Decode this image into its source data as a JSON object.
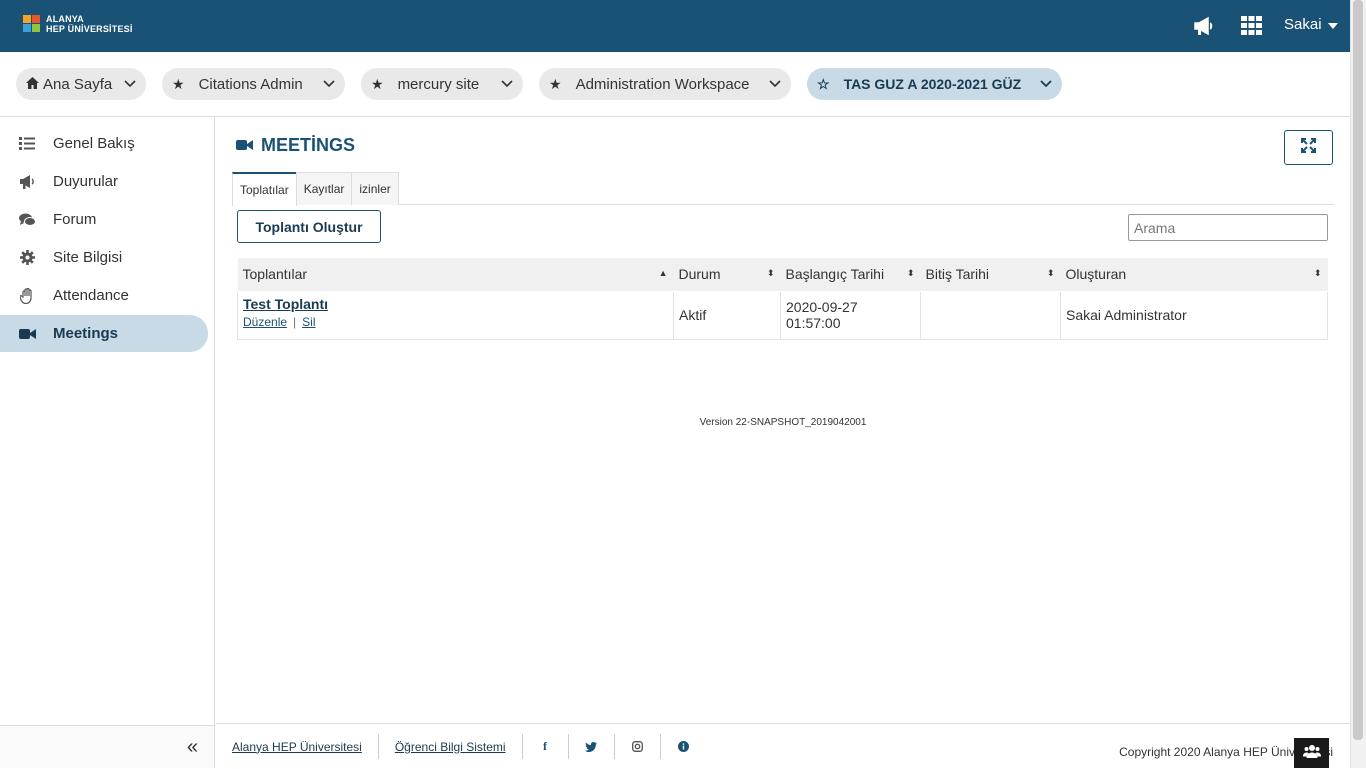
{
  "header": {
    "logo_line1": "ALANYA",
    "logo_line2": "HEP ÜNİVERSİTESİ",
    "user_name": "Sakai",
    "icons": [
      "bullhorn-icon",
      "apps-grid-icon"
    ]
  },
  "site_tabs": [
    {
      "label": "Ana Sayfa",
      "icon": "home-icon"
    },
    {
      "label": "Citations Admin",
      "icon": "star-icon"
    },
    {
      "label": "mercury site",
      "icon": "star-icon"
    },
    {
      "label": "Administration Workspace",
      "icon": "star-icon"
    },
    {
      "label": "TAS GUZ A 2020-2021 GÜZ",
      "icon": "star-outline-icon",
      "active": true
    }
  ],
  "sidebar": {
    "items": [
      {
        "label": "Genel Bakış",
        "icon": "list-icon"
      },
      {
        "label": "Duyurular",
        "icon": "bullhorn-icon"
      },
      {
        "label": "Forum",
        "icon": "comments-icon"
      },
      {
        "label": "Site Bilgisi",
        "icon": "gear-icon"
      },
      {
        "label": "Attendance",
        "icon": "hand-icon"
      },
      {
        "label": "Meetings",
        "icon": "video-camera-icon",
        "active": true
      }
    ]
  },
  "main": {
    "title": "MEETİNGS",
    "tabs": [
      {
        "label": "Toplatılar",
        "active": true
      },
      {
        "label": "Kayıtlar"
      },
      {
        "label": "izinler"
      }
    ],
    "create_button": "Toplantı Oluştur",
    "search_placeholder": "Arama",
    "table": {
      "headers": [
        "Toplantılar",
        "Durum",
        "Başlangıç Tarihi",
        "Bitiş Tarihi",
        "Oluşturan"
      ],
      "rows": [
        {
          "name": "Test Toplantı",
          "edit": "Düzenle",
          "separator": "|",
          "delete": "Sil",
          "status": "Aktif",
          "start_date": "2020-09-27",
          "start_time": "01:57:00",
          "end": "",
          "creator": "Sakai Administrator"
        }
      ]
    },
    "version": "Version 22-SNAPSHOT_2019042001"
  },
  "footer": {
    "links": [
      "Alanya HEP Üniversitesi",
      "Öğrenci Bilgi Sistemi"
    ],
    "social": [
      "facebook-icon",
      "twitter-icon",
      "instagram-icon",
      "info-icon"
    ],
    "copyright": "Copyright 2020 Alanya HEP Üniversitesi"
  },
  "colors": {
    "header": "#1a5276",
    "active_bg": "#c7dae6",
    "accent_text": "#1a3a52"
  }
}
